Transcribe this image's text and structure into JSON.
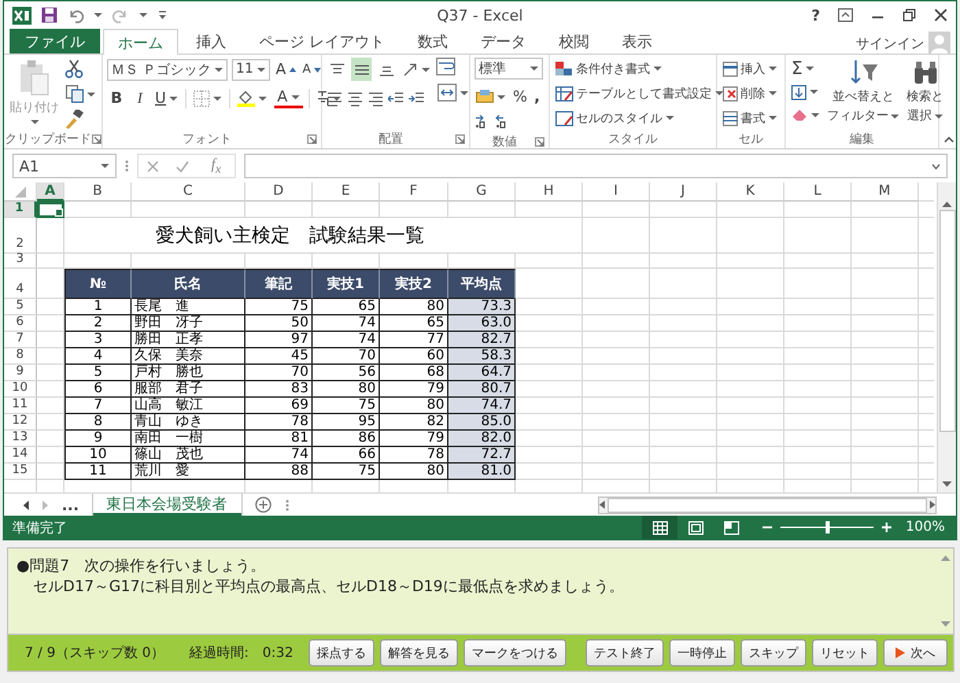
{
  "window": {
    "title": "Q37 - Excel",
    "help": "?",
    "sign_in": "サインイン"
  },
  "ribbon": {
    "tabs": [
      {
        "label": "ファイル",
        "kind": "file",
        "selected": false
      },
      {
        "label": "ホーム",
        "kind": "tab",
        "selected": true
      },
      {
        "label": "挿入",
        "kind": "tab",
        "selected": false
      },
      {
        "label": "ページ レイアウト",
        "kind": "tab",
        "selected": false
      },
      {
        "label": "数式",
        "kind": "tab",
        "selected": false
      },
      {
        "label": "データ",
        "kind": "tab",
        "selected": false
      },
      {
        "label": "校閲",
        "kind": "tab",
        "selected": false
      },
      {
        "label": "表示",
        "kind": "tab",
        "selected": false
      }
    ],
    "groups": [
      {
        "kind": "clipboard",
        "label": "クリップボード",
        "launcher": true,
        "paste": {
          "label": "貼り付け",
          "disabled": true
        }
      },
      {
        "kind": "font",
        "label": "フォント",
        "launcher": true,
        "font_name": "ＭＳ Ｐゴシック",
        "font_size": "11",
        "grow": "A",
        "shrink": "A",
        "bold": "B",
        "italic": "I",
        "underline": "U",
        "font_color": "A"
      },
      {
        "kind": "alignment",
        "label": "配置",
        "launcher": true,
        "vertical_align": [
          {
            "kind": "top",
            "selected": false
          },
          {
            "kind": "middle",
            "selected": true
          },
          {
            "kind": "bottom",
            "selected": false
          }
        ]
      },
      {
        "kind": "number",
        "label": "数値",
        "launcher": true,
        "format": "標準",
        "percent": "%",
        "comma": ","
      },
      {
        "kind": "styles",
        "label": "スタイル",
        "launcher": false,
        "items": [
          "条件付き書式",
          "テーブルとして書式設定",
          "セルのスタイル"
        ]
      },
      {
        "kind": "cells",
        "label": "セル",
        "launcher": false,
        "items": [
          "挿入",
          "削除",
          "書式"
        ]
      },
      {
        "kind": "editing",
        "label": "編集",
        "launcher": false,
        "sum": "Σ",
        "sort_lines": [
          "並べ替えと",
          "フィルター"
        ],
        "find_lines": [
          "検索と",
          "選択"
        ]
      }
    ]
  },
  "formula_bar": {
    "name_box": "A1",
    "function_label": "f$_{x}$"
  },
  "sheet": {
    "columns": [
      {
        "label": "A",
        "selected": true
      },
      {
        "label": "B",
        "selected": false
      },
      {
        "label": "C",
        "selected": false
      },
      {
        "label": "D",
        "selected": false
      },
      {
        "label": "E",
        "selected": false
      },
      {
        "label": "F",
        "selected": false
      },
      {
        "label": "G",
        "selected": false
      },
      {
        "label": "H",
        "selected": false
      },
      {
        "label": "I",
        "selected": false
      },
      {
        "label": "J",
        "selected": false
      },
      {
        "label": "K",
        "selected": false
      },
      {
        "label": "L",
        "selected": false
      },
      {
        "label": "M",
        "selected": false
      }
    ],
    "rows": [
      {
        "label": "1",
        "selected": true
      },
      {
        "label": "2",
        "selected": false
      },
      {
        "label": "3",
        "selected": false
      },
      {
        "label": "4",
        "selected": false
      },
      {
        "label": "5",
        "selected": false
      },
      {
        "label": "6",
        "selected": false
      },
      {
        "label": "7",
        "selected": false
      },
      {
        "label": "8",
        "selected": false
      },
      {
        "label": "9",
        "selected": false
      },
      {
        "label": "10",
        "selected": false
      },
      {
        "label": "11",
        "selected": false
      },
      {
        "label": "12",
        "selected": false
      },
      {
        "label": "13",
        "selected": false
      },
      {
        "label": "14",
        "selected": false
      },
      {
        "label": "15",
        "selected": false
      }
    ],
    "title": "愛犬飼い主検定　試験結果一覧",
    "table_header": [
      "№",
      "氏名",
      "筆記",
      "実技1",
      "実技2",
      "平均点"
    ],
    "table_rows": [
      [
        "1",
        "長尾　進",
        "75",
        "65",
        "80",
        "73.3"
      ],
      [
        "2",
        "野田　冴子",
        "50",
        "74",
        "65",
        "63.0"
      ],
      [
        "3",
        "勝田　正孝",
        "97",
        "74",
        "77",
        "82.7"
      ],
      [
        "4",
        "久保　美奈",
        "45",
        "70",
        "60",
        "58.3"
      ],
      [
        "5",
        "戸村　勝也",
        "70",
        "56",
        "68",
        "64.7"
      ],
      [
        "6",
        "服部　君子",
        "83",
        "80",
        "79",
        "80.7"
      ],
      [
        "7",
        "山高　敏江",
        "69",
        "75",
        "80",
        "74.7"
      ],
      [
        "8",
        "青山　ゆき",
        "78",
        "95",
        "82",
        "85.0"
      ],
      [
        "9",
        "南田　一樹",
        "81",
        "86",
        "79",
        "82.0"
      ],
      [
        "10",
        "篠山　茂也",
        "74",
        "66",
        "78",
        "72.7"
      ],
      [
        "11",
        "荒川　愛",
        "88",
        "75",
        "80",
        "81.0"
      ]
    ]
  },
  "sheet_tabs": {
    "more": "...",
    "tabs": [
      {
        "label": "東日本会場受験者",
        "selected": true
      }
    ]
  },
  "status_bar": {
    "status": "準備完了",
    "views": [
      {
        "kind": "normal",
        "selected": true
      },
      {
        "kind": "page_layout",
        "selected": false
      },
      {
        "kind": "page_break",
        "selected": false
      }
    ],
    "zoom": {
      "level": 0.5,
      "reading": "100%"
    }
  },
  "quiz": {
    "question": [
      "●問題7　次の操作を行いましょう。",
      "セルD17～G17に科目別と平均点の最高点、セルD18～D19に最低点を求めましょう。"
    ],
    "progress": "7 / 9（スキップ数 0）",
    "elapsed": "経過時間:　0:32",
    "actions": [
      {
        "label": "採点する",
        "kind": "plain"
      },
      {
        "label": "解答を見る",
        "kind": "plain"
      },
      {
        "label": "マークをつける",
        "kind": "plain"
      }
    ],
    "navigation": [
      {
        "label": "テスト終了",
        "kind": "plain"
      },
      {
        "label": "一時停止",
        "kind": "plain"
      },
      {
        "label": "スキップ",
        "kind": "plain"
      },
      {
        "label": "リセット",
        "kind": "plain"
      },
      {
        "label": "次へ",
        "kind": "next"
      }
    ]
  }
}
